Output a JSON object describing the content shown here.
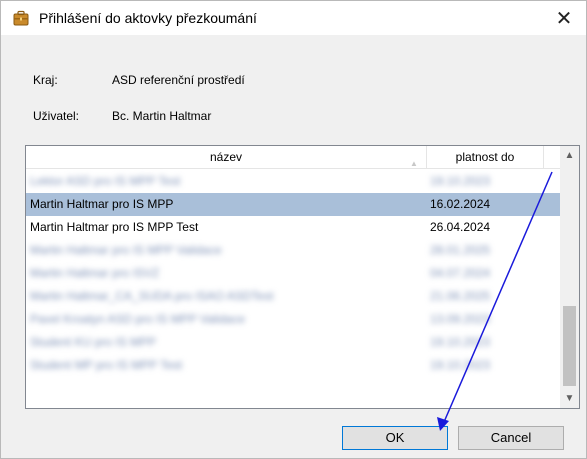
{
  "window": {
    "title": "Přihlášení do aktovky přezkoumání",
    "close_glyph": "✕"
  },
  "info": {
    "kraj_label": "Kraj:",
    "kraj_value": "ASD referenční prostředí",
    "user_label": "Uživatel:",
    "user_value": "Bc. Martin Haltmar"
  },
  "list": {
    "columns": [
      "název",
      "platnost do"
    ],
    "rows": [
      {
        "name": "Lektor ASD pro IS MPP Test",
        "date": "19.10.2023",
        "blurred": true,
        "selected": false
      },
      {
        "name": "Martin Haltmar pro IS MPP",
        "date": "16.02.2024",
        "blurred": false,
        "selected": true
      },
      {
        "name": "Martin Haltmar pro IS MPP Test",
        "date": "26.04.2024",
        "blurred": false,
        "selected": false
      },
      {
        "name": "Martin Haltmar pro IS MPP Validace",
        "date": "28.01.2025",
        "blurred": true,
        "selected": false
      },
      {
        "name": "Martin Haltmar pro ISVZ",
        "date": "04.07.2024",
        "blurred": true,
        "selected": false
      },
      {
        "name": "Martin Haltmar_CA_SUDA pro ISAO ASDTest",
        "date": "21.06.2025",
        "blurred": true,
        "selected": false
      },
      {
        "name": "Pavel Kroatyn ASD pro IS MPP Validace",
        "date": "13.09.2023",
        "blurred": true,
        "selected": false
      },
      {
        "name": "Student KU pro IS MPP",
        "date": "19.10.2023",
        "blurred": true,
        "selected": false
      },
      {
        "name": "Student MP pro IS MPP Test",
        "date": "19.10.2023",
        "blurred": true,
        "selected": false
      }
    ]
  },
  "buttons": {
    "ok": "OK",
    "cancel": "Cancel"
  },
  "colors": {
    "selected_row": "#a9bfd9",
    "annotation_arrow": "#1a1adb"
  }
}
